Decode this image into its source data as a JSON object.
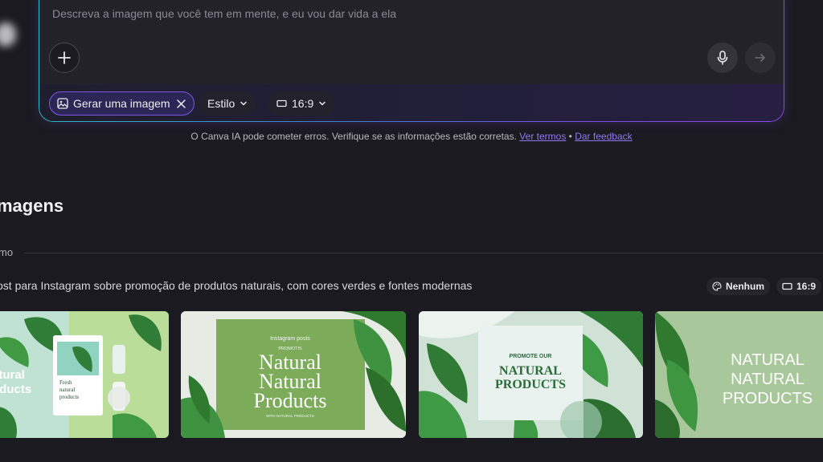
{
  "prompt": {
    "placeholder": "Descreva a imagem que você tem em mente, e eu vou dar vida a ela"
  },
  "toolbar": {
    "chip_generate": "Gerar uma imagem",
    "chip_style": "Estilo",
    "chip_ratio": "16:9"
  },
  "disclaimer": {
    "text": "O Canva IA pode cometer erros. Verifique se as informações estão corretas.",
    "terms_link": "Ver termos",
    "separator": "•",
    "feedback_link": "Dar feedback"
  },
  "section": {
    "title": "magens",
    "subtitle": "mo"
  },
  "result": {
    "prompt_text": "ost para Instagram sobre promoção de produtos naturais, com cores verdes e fontes modernas",
    "tag_style": "Nenhum",
    "tag_ratio": "16:9"
  },
  "thumbnails": [
    {
      "caption_1": "atural",
      "caption_2": "oducts",
      "card_line_1": "Fresh",
      "card_line_2": "natural",
      "card_line_3": "products"
    },
    {
      "top_line": "Instagram posts",
      "sub_line": "PROMOTIS",
      "line_1": "Natural",
      "line_2": "Natural",
      "line_3": "Products",
      "footer": "WITH NATURAL PRODUCTS"
    },
    {
      "top_line": "PROMOTE OUR",
      "line_1": "NATURAL",
      "line_2": "PRODUCTS"
    },
    {
      "line_1": "NATURAL",
      "line_2": "NATURAL",
      "line_3": "PRODUCTS"
    }
  ],
  "colors": {
    "accent_purple": "#7b57e6",
    "link": "#8f79f5",
    "leaf_green": "#3d8a3a"
  }
}
